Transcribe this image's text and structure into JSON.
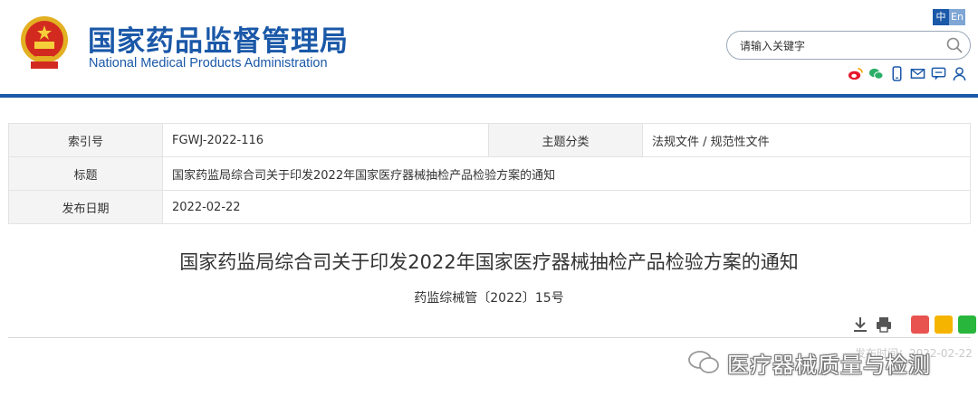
{
  "header": {
    "title": "国家药品监督管理局",
    "subtitle": "National Medical Products Administration",
    "lang_zh": "中",
    "lang_en": "En",
    "search_placeholder": "请输入关键字",
    "icons": [
      "emblem-icon",
      "search-icon",
      "weibo-icon",
      "wechat-icon",
      "mobile-icon",
      "mail-icon",
      "message-icon",
      "user-icon"
    ],
    "brand_color": "#1a58a8"
  },
  "info": {
    "index_label": "索引号",
    "index_value": "FGWJ-2022-116",
    "category_label": "主题分类",
    "category_value": "法规文件 / 规范性文件",
    "title_label": "标题",
    "title_value": "国家药监局综合司关于印发2022年国家医疗器械抽检产品检验方案的通知",
    "date_label": "发布日期",
    "date_value": "2022-02-22"
  },
  "article": {
    "title": "国家药监局综合司关于印发2022年国家医疗器械抽检产品检验方案的通知",
    "doc_number": "药监综械管〔2022〕15号",
    "tool_icons": [
      "download-icon",
      "print-icon",
      "weibo-share-icon",
      "qzone-share-icon",
      "wechat-share-icon"
    ]
  },
  "watermark": {
    "text": "医疗器械质量与检测",
    "mark": "发布时间：2022-02-22"
  }
}
